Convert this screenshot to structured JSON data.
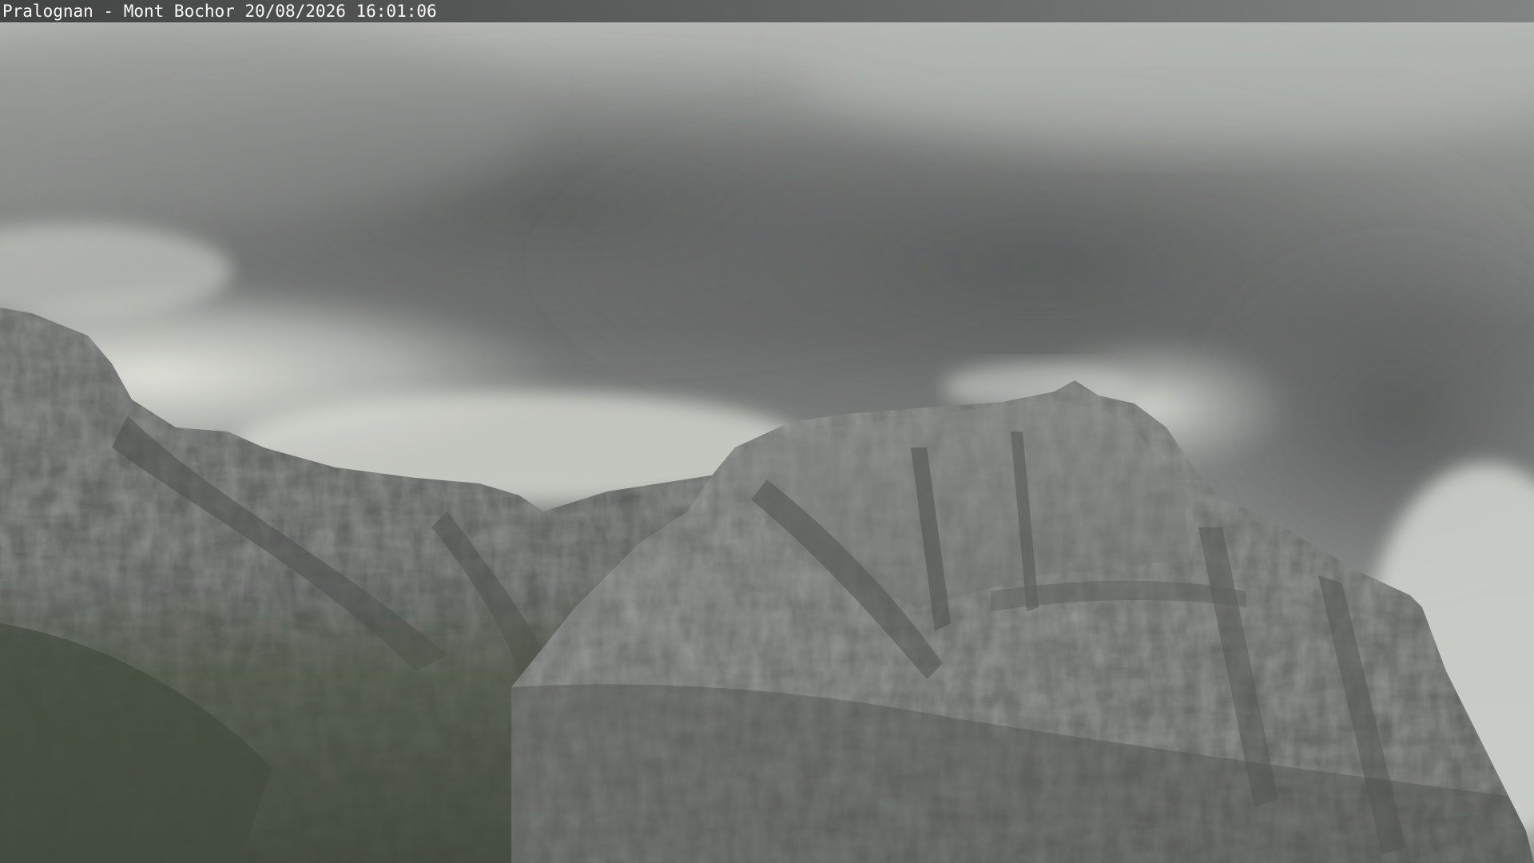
{
  "overlay": {
    "caption": "Pralognan - Mont Bochor 20/08/2026 16:01:06"
  },
  "scene": {
    "description_icon": "mountain-landscape",
    "colors": {
      "sky_dark": "#5c5f5e",
      "sky_mid": "#8a8d8b",
      "sky_light": "#d8dcd6",
      "cloud_glow": "#e6e9e1",
      "rock_light": "#8b8e8a",
      "rock_mid": "#6d706c",
      "rock_dark": "#4b4e4b",
      "vegetation": "#4a5445"
    }
  }
}
